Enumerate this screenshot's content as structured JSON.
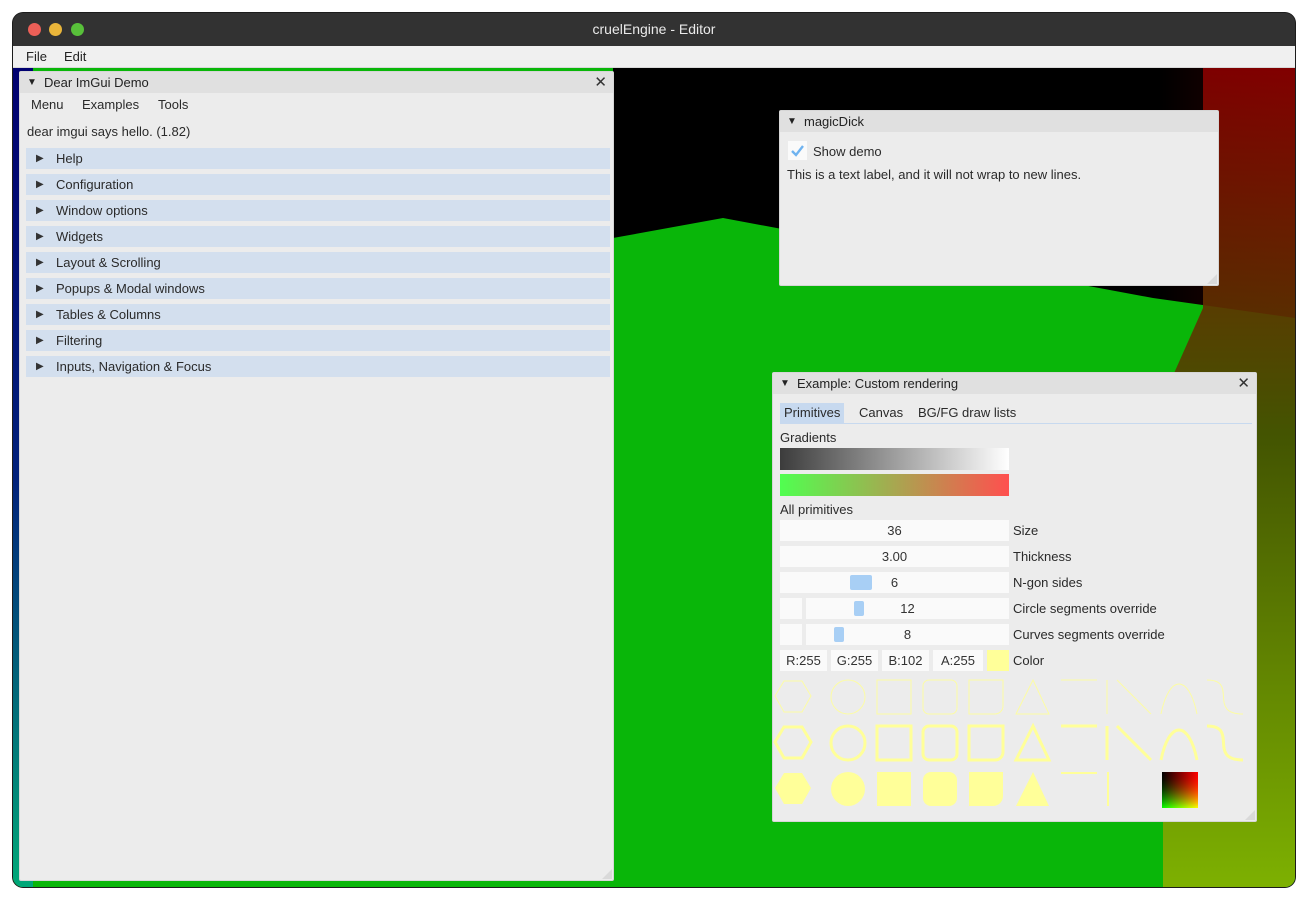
{
  "app": {
    "window_title": "cruelEngine - Editor",
    "menu": [
      "File",
      "Edit"
    ]
  },
  "demo_window": {
    "title": "Dear ImGui Demo",
    "menubar": [
      "Menu",
      "Examples",
      "Tools"
    ],
    "hello_text": "dear imgui says hello. (1.82)",
    "sections": [
      "Help",
      "Configuration",
      "Window options",
      "Widgets",
      "Layout & Scrolling",
      "Popups & Modal windows",
      "Tables & Columns",
      "Filtering",
      "Inputs, Navigation & Focus"
    ]
  },
  "magic_window": {
    "title": "magicDick",
    "checkbox_label": "Show demo",
    "checkbox_checked": true,
    "text_label": "This is a text label, and it will not wrap to new lines."
  },
  "custom_window": {
    "title": "Example: Custom rendering",
    "tabs": [
      "Primitives",
      "Canvas",
      "BG/FG draw lists"
    ],
    "active_tab": "Primitives",
    "gradients_label": "Gradients",
    "all_primitives_label": "All primitives",
    "size": {
      "value": "36",
      "label": "Size"
    },
    "thickness": {
      "value": "3.00",
      "label": "Thickness"
    },
    "ngon": {
      "value": "6",
      "label": "N-gon sides"
    },
    "circle_segments": {
      "value": "12",
      "label": "Circle segments override"
    },
    "curve_segments": {
      "value": "8",
      "label": "Curves segments override"
    },
    "color": {
      "r": "R:255",
      "g": "G:255",
      "b": "B:102",
      "a": "A:255",
      "label": "Color",
      "swatch": "#ffff99"
    }
  },
  "colors": {
    "accent": "#a8cff5",
    "header_bg": "#d3dfee",
    "viewport_green": "#0ab80a",
    "primitive": "#ffff99"
  }
}
